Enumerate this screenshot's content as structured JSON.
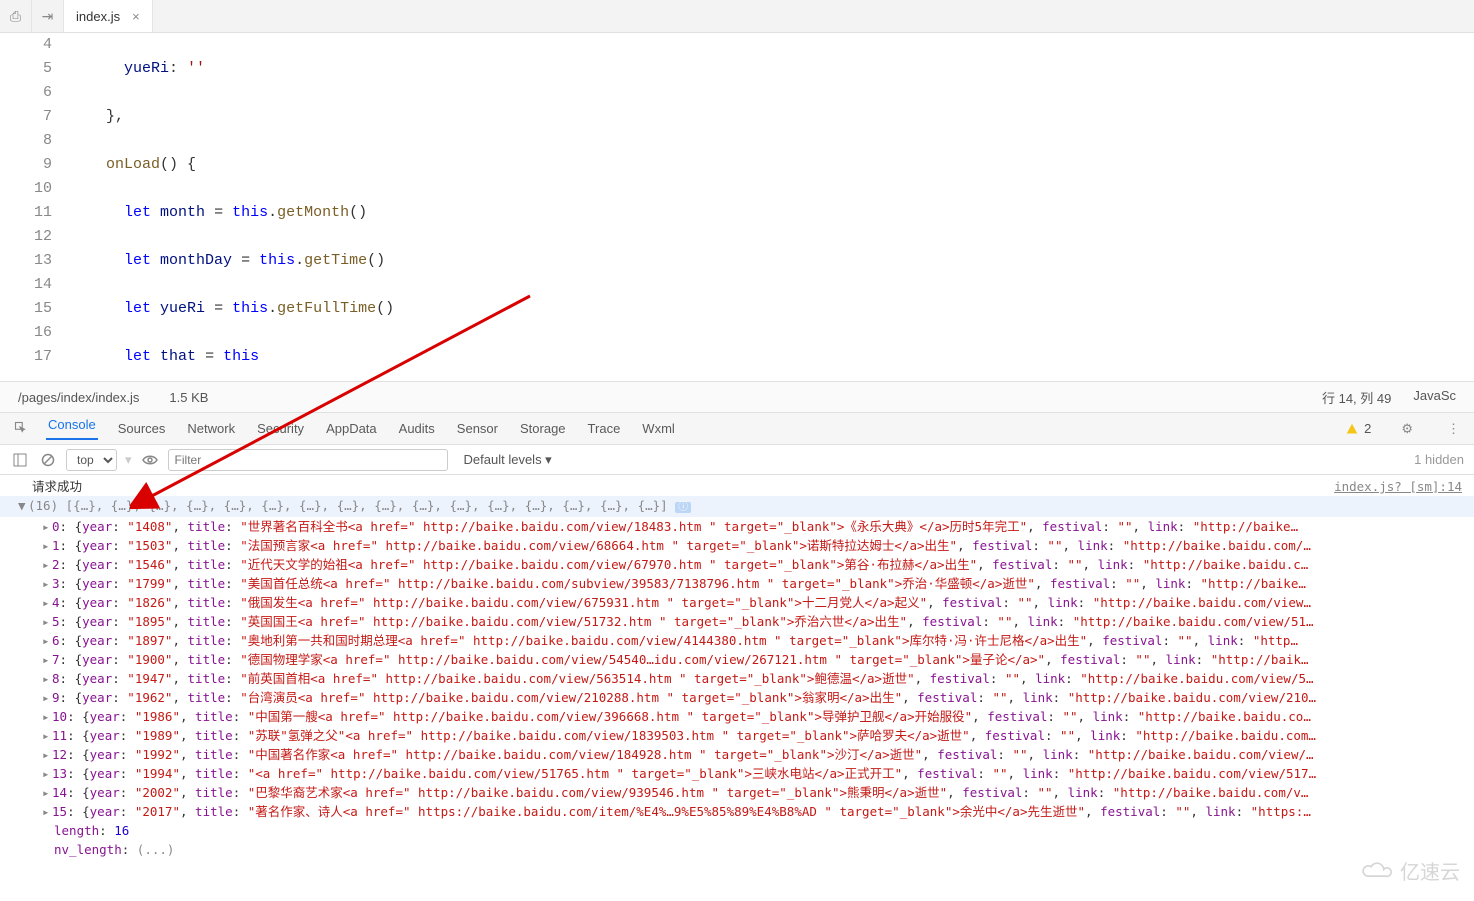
{
  "tab": {
    "title": "index.js"
  },
  "editor": {
    "lines": [
      4,
      5,
      6,
      7,
      8,
      9,
      10,
      11,
      12,
      13,
      14,
      15,
      16,
      17
    ],
    "code_static": true
  },
  "statusbar": {
    "path": "/pages/index/index.js",
    "size": "1.5 KB",
    "position": "行 14, 列 49",
    "language": "JavaSc"
  },
  "devtabs": [
    "Console",
    "Sources",
    "Network",
    "Security",
    "AppData",
    "Audits",
    "Sensor",
    "Storage",
    "Trace",
    "Wxml"
  ],
  "devsel": "Console",
  "warn_count": "2",
  "toolbar": {
    "context": "top",
    "filter_placeholder": "Filter",
    "levels": "Default levels ▾",
    "hidden": "1 hidden"
  },
  "console_header": {
    "msg": "请求成功",
    "count": "(16)",
    "source": "index.js? [sm]:14",
    "array_preview": "[{…}, {…}, {…}, {…}, {…}, {…}, {…}, {…}, {…}, {…}, {…}, {…}, {…}, {…}, {…}, {…}]"
  },
  "length_label": "length",
  "length_value": "16",
  "nv_label": "nv_length",
  "nv_value": "(...)",
  "entries": [
    {
      "idx": 0,
      "year": "1408",
      "title_text": "世界著名百科全书<a href=\" http://baike.baidu.com/view/18483.htm \" target=\"_blank\">《永乐大典》</a>历时5年完工",
      "festival": "",
      "link": "http://baike…"
    },
    {
      "idx": 1,
      "year": "1503",
      "title_text": "法国预言家<a href=\" http://baike.baidu.com/view/68664.htm \" target=\"_blank\">诺斯特拉达姆士</a>出生",
      "festival": "",
      "link": "http://baike.baidu.com/…"
    },
    {
      "idx": 2,
      "year": "1546",
      "title_text": "近代天文学的始祖<a href=\" http://baike.baidu.com/view/67970.htm \" target=\"_blank\">第谷·布拉赫</a>出生",
      "festival": "",
      "link": "http://baike.baidu.c…"
    },
    {
      "idx": 3,
      "year": "1799",
      "title_text": "美国首任总统<a href=\" http://baike.baidu.com/subview/39583/7138796.htm \" target=\"_blank\">乔治·华盛顿</a>逝世",
      "festival": "",
      "link": "http://baike…"
    },
    {
      "idx": 4,
      "year": "1826",
      "title_text": "俄国发生<a href=\" http://baike.baidu.com/view/675931.htm \" target=\"_blank\">十二月党人</a>起义",
      "festival": "",
      "link": "http://baike.baidu.com/view…"
    },
    {
      "idx": 5,
      "year": "1895",
      "title_text": "英国国王<a href=\" http://baike.baidu.com/view/51732.htm \" target=\"_blank\">乔治六世</a>出生",
      "festival": "",
      "link": "http://baike.baidu.com/view/51…"
    },
    {
      "idx": 6,
      "year": "1897",
      "title_text": "奥地利第一共和国时期总理<a href=\" http://baike.baidu.com/view/4144380.htm \" target=\"_blank\">库尔特·冯·许士尼格</a>出生",
      "festival": "",
      "link": "http…"
    },
    {
      "idx": 7,
      "year": "1900",
      "title_text": "德国物理学家<a href=\" http://baike.baidu.com/view/54540…idu.com/view/267121.htm \" target=\"_blank\">量子论</a>",
      "festival": "",
      "link": "http://baik…"
    },
    {
      "idx": 8,
      "year": "1947",
      "title_text": "前英国首相<a href=\" http://baike.baidu.com/view/563514.htm \" target=\"_blank\">鲍德温</a>逝世",
      "festival": "",
      "link": "http://baike.baidu.com/view/5…"
    },
    {
      "idx": 9,
      "year": "1962",
      "title_text": "台湾演员<a href=\" http://baike.baidu.com/view/210288.htm \" target=\"_blank\">翁家明</a>出生",
      "festival": "",
      "link": "http://baike.baidu.com/view/210…"
    },
    {
      "idx": 10,
      "year": "1986",
      "title_text": "中国第一艘<a href=\" http://baike.baidu.com/view/396668.htm \" target=\"_blank\">导弹护卫舰</a>开始服役",
      "festival": "",
      "link": "http://baike.baidu.co…"
    },
    {
      "idx": 11,
      "year": "1989",
      "title_text": "苏联\"氢弹之父\"<a href=\" http://baike.baidu.com/view/1839503.htm \" target=\"_blank\">萨哈罗夫</a>逝世",
      "festival": "",
      "link": "http://baike.baidu.com…"
    },
    {
      "idx": 12,
      "year": "1992",
      "title_text": "中国著名作家<a href=\" http://baike.baidu.com/view/184928.htm \" target=\"_blank\">沙汀</a>逝世",
      "festival": "",
      "link": "http://baike.baidu.com/view/…"
    },
    {
      "idx": 13,
      "year": "1994",
      "title_text": "<a href=\" http://baike.baidu.com/view/51765.htm \" target=\"_blank\">三峡水电站</a>正式开工",
      "festival": "",
      "link": "http://baike.baidu.com/view/517…"
    },
    {
      "idx": 14,
      "year": "2002",
      "title_text": "巴黎华裔艺术家<a href=\" http://baike.baidu.com/view/939546.htm \" target=\"_blank\">熊秉明</a>逝世",
      "festival": "",
      "link": "http://baike.baidu.com/v…"
    },
    {
      "idx": 15,
      "year": "2017",
      "title_text": "著名作家、诗人<a href=\" https://baike.baidu.com/item/%E4%…9%E5%85%89%E4%B8%AD \" target=\"_blank\">余光中</a>先生逝世",
      "festival": "",
      "link": "https:…"
    }
  ],
  "watermark": "亿速云"
}
